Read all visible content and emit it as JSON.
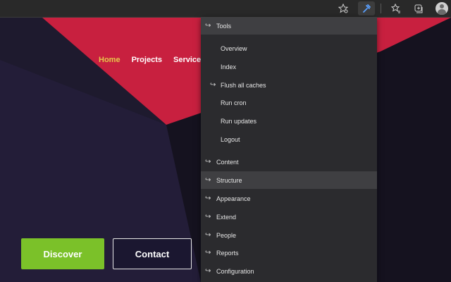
{
  "toolbar": {
    "icons": [
      "favorite-settings-icon",
      "extension-tools-icon",
      "favorites-icon",
      "collections-icon",
      "profile-icon"
    ]
  },
  "nav": {
    "items": [
      {
        "label": "Home",
        "current": true
      },
      {
        "label": "Projects",
        "current": false
      },
      {
        "label": "Services",
        "current": false
      }
    ]
  },
  "hero": {
    "discover_label": "Discover",
    "contact_label": "Contact",
    "colors": {
      "red": "#c8203f",
      "green": "#7bc129",
      "dark": "#1e1a2e"
    }
  },
  "menu": {
    "tools_label": "Tools",
    "tools_sub": [
      "Overview",
      "Index",
      "Flush all caches",
      "Run cron",
      "Run updates",
      "Logout"
    ],
    "top": [
      "Content",
      "Structure",
      "Appearance",
      "Extend",
      "People",
      "Reports",
      "Configuration"
    ],
    "highlighted": "Structure"
  }
}
